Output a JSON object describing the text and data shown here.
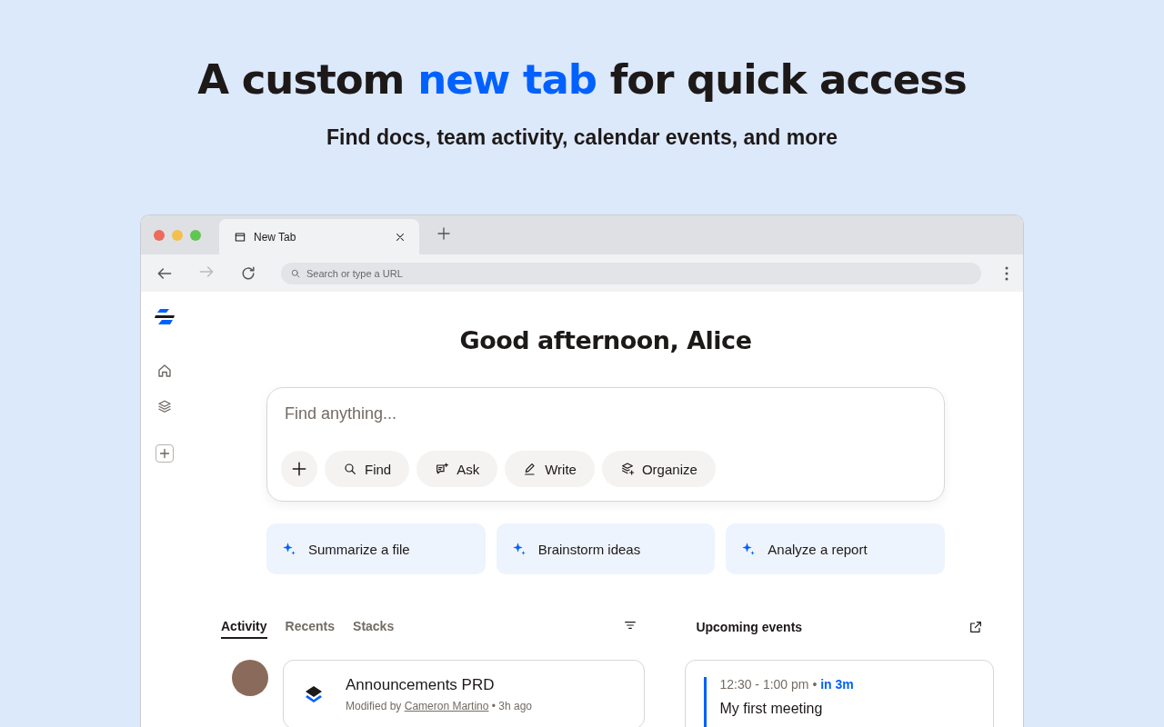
{
  "hero": {
    "headline_before": "A custom",
    "headline_highlight": "new tab",
    "headline_after": "for quick access",
    "subtitle": "Find docs, team activity, calendar events, and more"
  },
  "browser": {
    "tab_title": "New Tab",
    "address_placeholder": "Search or type a URL"
  },
  "greeting": "Good afternoon, Alice",
  "search": {
    "placeholder": "Find anything...",
    "actions": [
      {
        "kind": "find",
        "label": "Find"
      },
      {
        "kind": "ask",
        "label": "Ask"
      },
      {
        "kind": "write",
        "label": "Write"
      },
      {
        "kind": "organize",
        "label": "Organize"
      }
    ]
  },
  "suggestions": [
    "Summarize a file",
    "Brainstorm ideas",
    "Analyze a report"
  ],
  "activity": {
    "tabs": [
      {
        "label": "Activity",
        "selected": true
      },
      {
        "label": "Recents",
        "selected": false
      },
      {
        "label": "Stacks",
        "selected": false
      }
    ],
    "items": [
      {
        "title": "Announcements PRD",
        "prefix": "Modified by",
        "person": "Cameron Martino",
        "separator": "•",
        "time": "3h ago"
      }
    ]
  },
  "events": {
    "title": "Upcoming events",
    "items": [
      {
        "time": "12:30 - 1:00 pm",
        "separator": "•",
        "countdown": "in 3m",
        "title": "My first meeting",
        "color": "#0061fe"
      }
    ]
  }
}
